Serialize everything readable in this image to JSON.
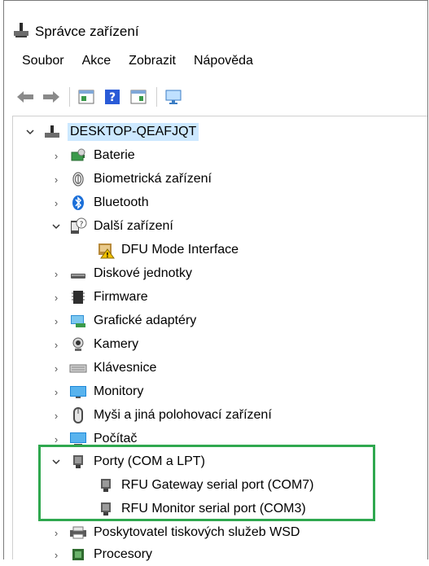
{
  "window": {
    "title": "Správce zařízení"
  },
  "menu": [
    "Soubor",
    "Akce",
    "Zobrazit",
    "Nápověda"
  ],
  "tree": {
    "root": "DESKTOP-QEAFJQT",
    "items": [
      {
        "label": "Baterie",
        "icon": "battery-icon"
      },
      {
        "label": "Biometrická zařízení",
        "icon": "fingerprint-icon"
      },
      {
        "label": "Bluetooth",
        "icon": "bluetooth-icon"
      },
      {
        "label": "Další zařízení",
        "icon": "unknown-device-icon"
      },
      {
        "label": "DFU Mode Interface",
        "icon": "warning-device-icon"
      },
      {
        "label": "Diskové jednotky",
        "icon": "disk-drive-icon"
      },
      {
        "label": "Firmware",
        "icon": "firmware-icon"
      },
      {
        "label": "Grafické adaptéry",
        "icon": "display-adapter-icon"
      },
      {
        "label": "Kamery",
        "icon": "camera-icon"
      },
      {
        "label": "Klávesnice",
        "icon": "keyboard-icon"
      },
      {
        "label": "Monitory",
        "icon": "monitor-icon"
      },
      {
        "label": "Myši a jiná polohovací zařízení",
        "icon": "mouse-icon"
      },
      {
        "label": "Počítač",
        "icon": "computer-icon"
      },
      {
        "label": "Porty (COM a LPT)",
        "icon": "port-icon"
      },
      {
        "label": "RFU Gateway serial port (COM7)",
        "icon": "port-icon"
      },
      {
        "label": "RFU Monitor serial port (COM3)",
        "icon": "port-icon"
      },
      {
        "label": "Poskytovatel tiskových služeb WSD",
        "icon": "printer-icon"
      },
      {
        "label": "Procesory",
        "icon": "processor-icon"
      }
    ]
  },
  "colors": {
    "highlight": "#2fa84f",
    "selection": "#cce8ff"
  }
}
